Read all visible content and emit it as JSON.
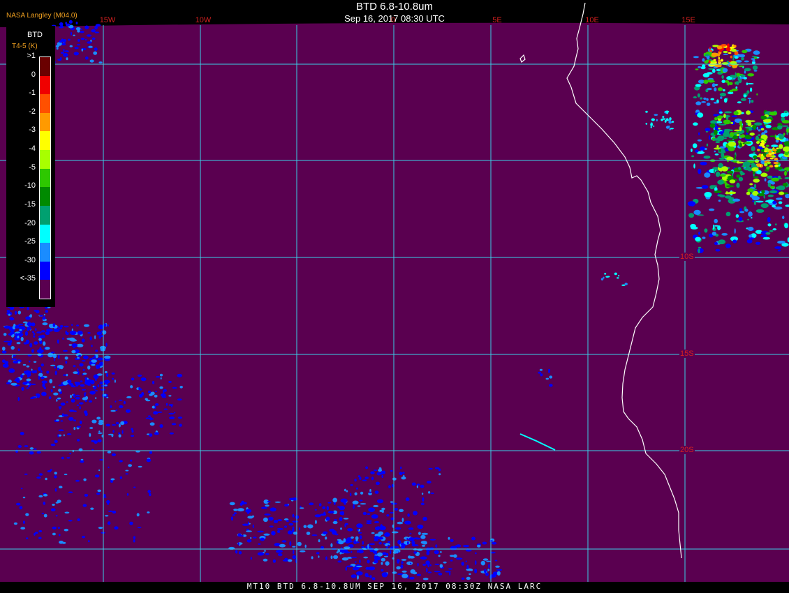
{
  "header": {
    "title": "BTD 6.8-10.8um",
    "subtitle": "Sep 16, 2017 08:30 UTC",
    "attribution": "NASA Langley (M04.0)"
  },
  "footer": {
    "text": "MT10  BTD 6.8-10.8UM  SEP 16, 2017 08:30Z  NASA LARC"
  },
  "map": {
    "background_color": "#5a0050",
    "grid_color": "#3ad0e8",
    "coast_color": "#ffffff",
    "longitude_labels": [
      "15W",
      "10W",
      "0",
      "5E",
      "10E",
      "15E"
    ],
    "latitude_labels": [
      "10S",
      "15S",
      "20S"
    ]
  },
  "legend": {
    "title": "BTD",
    "units": "T4-5 (K)",
    "items": [
      {
        "label": ">1",
        "color": "#6a0000"
      },
      {
        "label": "0",
        "color": "#f00000"
      },
      {
        "label": "-1",
        "color": "#ff5000"
      },
      {
        "label": "-2",
        "color": "#ff9a00"
      },
      {
        "label": "-3",
        "color": "#ffff00"
      },
      {
        "label": "-4",
        "color": "#a8ff00"
      },
      {
        "label": "-5",
        "color": "#2ec800"
      },
      {
        "label": "-10",
        "color": "#008a00"
      },
      {
        "label": "-15",
        "color": "#00a070"
      },
      {
        "label": "-20",
        "color": "#00ffff"
      },
      {
        "label": "-25",
        "color": "#1a8cff"
      },
      {
        "label": "-30",
        "color": "#0000ff"
      },
      {
        "label": "<-35",
        "color": "#5a0050"
      }
    ]
  }
}
